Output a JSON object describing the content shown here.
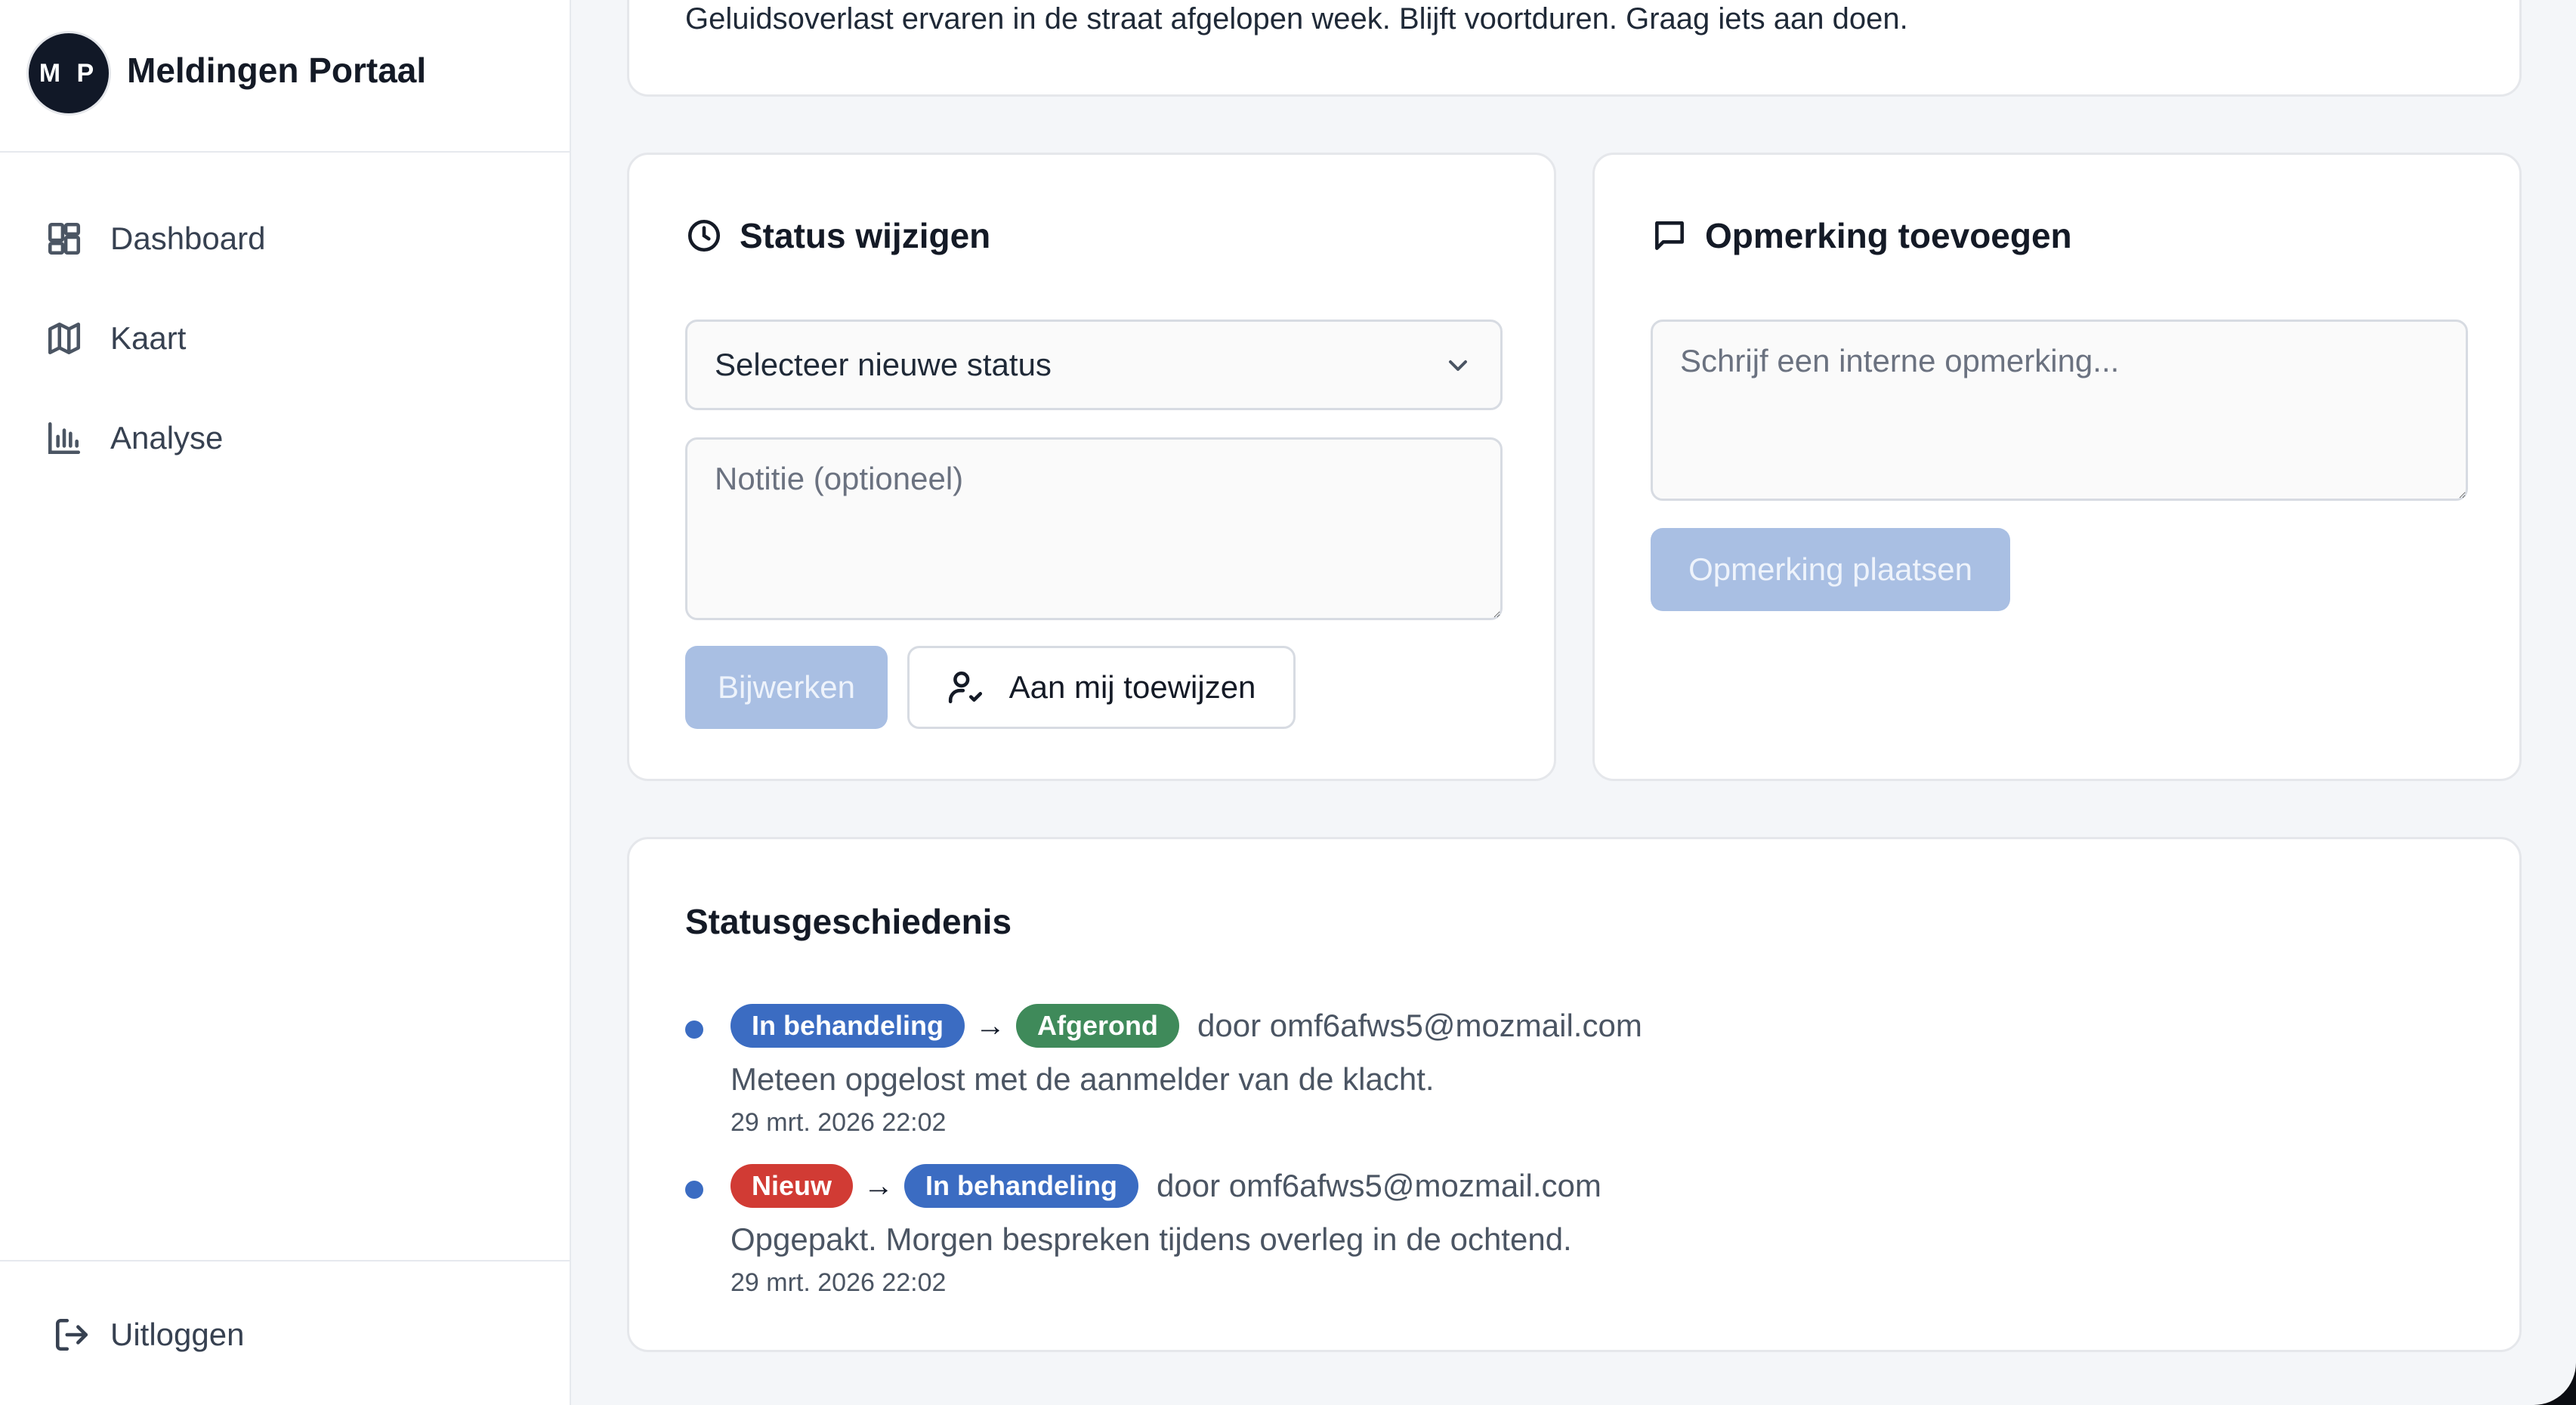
{
  "sidebar": {
    "avatar_initials": "M P",
    "brand_title": "Meldingen Portaal",
    "items": [
      {
        "label": "Dashboard",
        "icon": "dashboard-icon"
      },
      {
        "label": "Kaart",
        "icon": "map-icon"
      },
      {
        "label": "Analyse",
        "icon": "bar-chart-icon"
      }
    ],
    "logout_label": "Uitloggen"
  },
  "description": {
    "text": "Geluidsoverlast ervaren in de straat afgelopen week. Blijft voortduren. Graag iets aan doen."
  },
  "status_panel": {
    "title": "Status wijzigen",
    "select_value": "Selecteer nieuwe status",
    "note_placeholder": "Notitie (optioneel)",
    "update_label": "Bijwerken",
    "assign_label": "Aan mij toewijzen"
  },
  "comment_panel": {
    "title": "Opmerking toevoegen",
    "placeholder": "Schrijf een interne opmerking...",
    "post_label": "Opmerking plaatsen"
  },
  "history": {
    "title": "Statusgeschiedenis",
    "entries": [
      {
        "from": "In behandeling",
        "to": "Afgerond",
        "by": "door omf6afws5@mozmail.com",
        "note": "Meteen opgelost met de aanmelder van de klacht.",
        "time": "29 mrt. 2026 22:02"
      },
      {
        "from": "Nieuw",
        "to": "In behandeling",
        "by": "door omf6afws5@mozmail.com",
        "note": "Opgepakt. Morgen bespreken tijdens overleg in de ochtend.",
        "time": "29 mrt. 2026 22:02"
      }
    ]
  },
  "colors": {
    "accent": "#3b6cc2",
    "badge_in_progress": "#3b6cc2",
    "badge_done": "#3f8a5a",
    "badge_new": "#d13b34",
    "disabled_primary": "#a9bfe3"
  }
}
